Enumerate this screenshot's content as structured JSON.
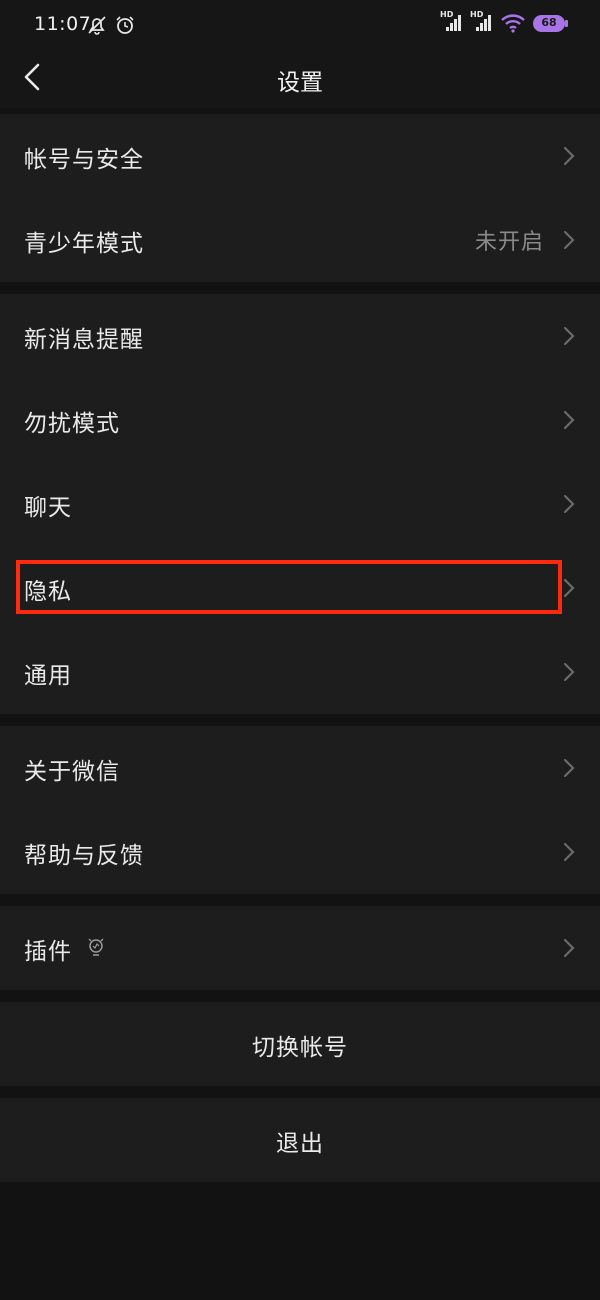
{
  "status_bar": {
    "time": "11:07",
    "icons": [
      "mute-bell-icon",
      "alarm-icon",
      "hd-signal-icon",
      "hd-signal-icon",
      "wifi-icon",
      "battery-icon"
    ],
    "battery_level": "68",
    "signal_label_1": "HD",
    "signal_label_2": "HD"
  },
  "nav": {
    "title": "设置",
    "back_icon": "chevron-left-icon"
  },
  "groups": {
    "account": [
      {
        "label": "帐号与安全"
      },
      {
        "label": "青少年模式",
        "value": "未开启"
      }
    ],
    "notifications": [
      {
        "label": "新消息提醒"
      },
      {
        "label": "勿扰模式"
      },
      {
        "label": "聊天"
      },
      {
        "label": "隐私"
      },
      {
        "label": "通用"
      }
    ],
    "about": [
      {
        "label": "关于微信"
      },
      {
        "label": "帮助与反馈"
      }
    ],
    "plugins": [
      {
        "label": "插件",
        "icon": "lightbulb-icon"
      }
    ]
  },
  "actions": {
    "switch_account": "切换帐号",
    "logout": "退出"
  },
  "colors": {
    "background": "#121212",
    "cell": "#1d1d1d",
    "highlight_box": "#ff2a10",
    "secondary_text": "#8a8a8a",
    "battery_fill": "#a874e8"
  }
}
